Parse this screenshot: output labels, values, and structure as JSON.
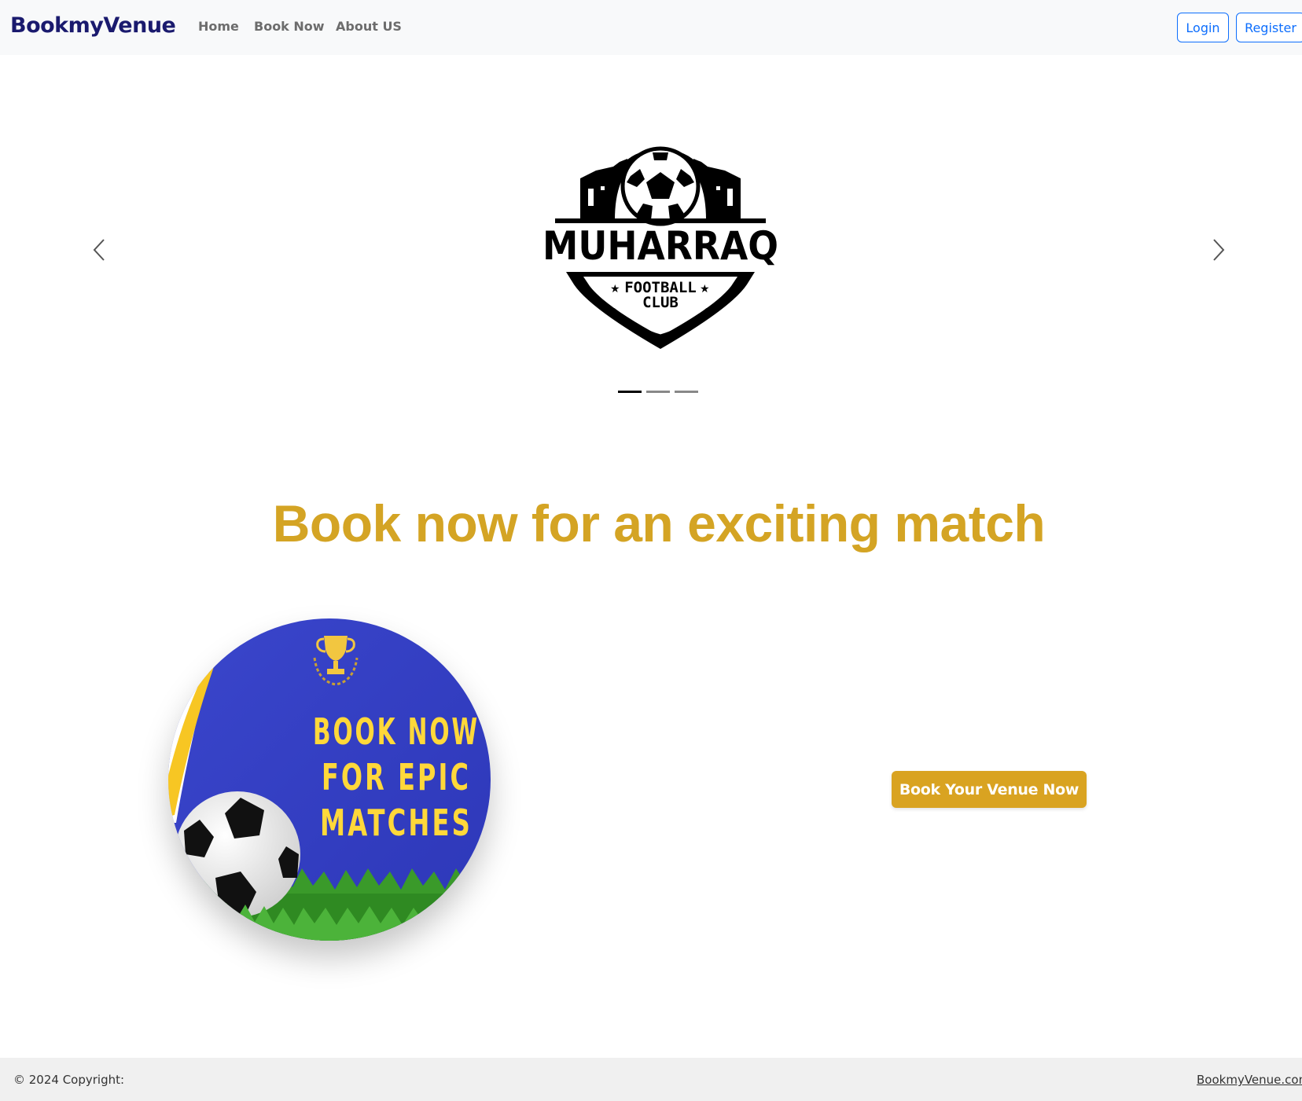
{
  "navbar": {
    "brand": "BookmyVenue",
    "links": [
      "Home",
      "Book Now",
      "About US"
    ],
    "login_label": "Login",
    "register_label": "Register"
  },
  "carousel": {
    "slide_logo": {
      "name": "MUHARRAQ",
      "subtitle_line1": "FOOTBALL",
      "subtitle_line2": "CLUB"
    },
    "indicator_count": 3,
    "active_index": 0
  },
  "headline": "Book now for an exciting match",
  "promo": {
    "lines": [
      "BOOK NOW",
      "FOR EPIC",
      "MATCHES"
    ]
  },
  "cta_label": "Book Your Venue Now",
  "footer": {
    "copyright": "© 2024 Copyright:",
    "link": "BookmyVenue.com"
  },
  "colors": {
    "accent": "#d4a424",
    "brand": "#1a1a6e",
    "primary": "#0d6efd",
    "promo_blue": "#3340c4"
  }
}
